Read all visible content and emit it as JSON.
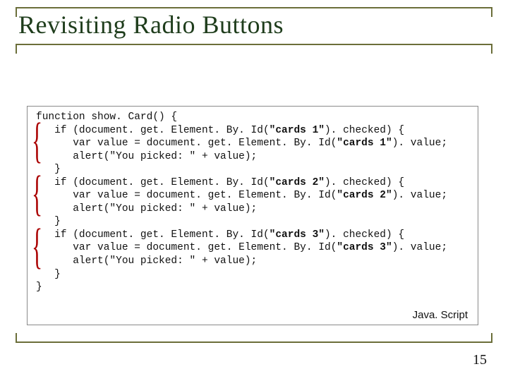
{
  "title": "Revisiting Radio Buttons",
  "code": {
    "line1": "function show. Card() {",
    "block1": {
      "ifOpen_a": "   if (document. get. Element. By. Id(",
      "ifOpen_id": "\"cards 1\"",
      "ifOpen_b": "). checked) {",
      "l2a": "      var value = document. get. Element. By. Id(",
      "l2id": "\"cards 1\"",
      "l2b": "). value;",
      "l3": "      alert(\"You picked: \" + value);",
      "close": "   }"
    },
    "block2": {
      "ifOpen_a": "   if (document. get. Element. By. Id(",
      "ifOpen_id": "\"cards 2\"",
      "ifOpen_b": "). checked) {",
      "l2a": "      var value = document. get. Element. By. Id(",
      "l2id": "\"cards 2\"",
      "l2b": "). value;",
      "l3": "      alert(\"You picked: \" + value);",
      "close": "   }"
    },
    "block3": {
      "ifOpen_a": "   if (document. get. Element. By. Id(",
      "ifOpen_id": "\"cards 3\"",
      "ifOpen_b": "). checked) {",
      "l2a": "      var value = document. get. Element. By. Id(",
      "l2id": "\"cards 3\"",
      "l2b": "). value;",
      "l3": "      alert(\"You picked: \" + value);",
      "close": "   }"
    },
    "end": "}"
  },
  "langLabel": "Java. Script",
  "pageNumber": "15"
}
